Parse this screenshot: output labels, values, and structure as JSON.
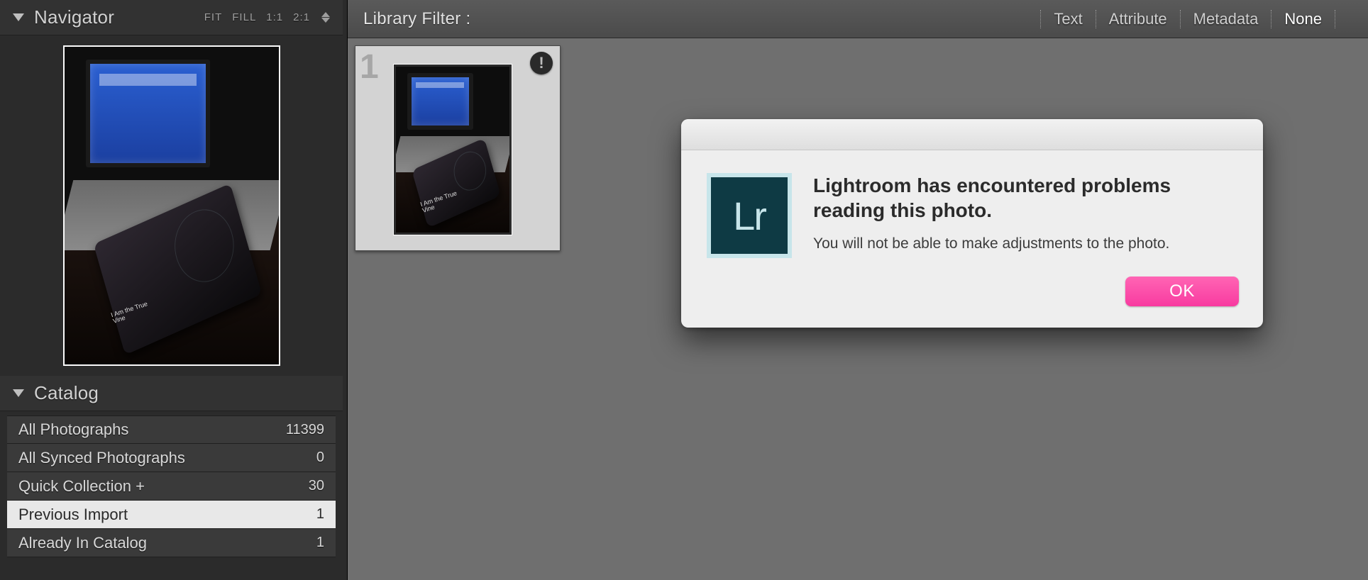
{
  "sidebar": {
    "navigator": {
      "title": "Navigator",
      "zoom": {
        "fit": "FIT",
        "fill": "FILL",
        "one_one": "1:1",
        "two_one": "2:1"
      },
      "preview_caption": "I Am the True\nVine"
    },
    "catalog": {
      "title": "Catalog",
      "items": [
        {
          "label": "All Photographs",
          "count": "11399",
          "selected": false
        },
        {
          "label": "All Synced Photographs",
          "count": "0",
          "selected": false
        },
        {
          "label": "Quick Collection  +",
          "count": "30",
          "selected": false
        },
        {
          "label": "Previous Import",
          "count": "1",
          "selected": true
        },
        {
          "label": "Already In Catalog",
          "count": "1",
          "selected": false
        }
      ]
    }
  },
  "filter_bar": {
    "title": "Library Filter :",
    "options": [
      {
        "label": "Text",
        "active": false
      },
      {
        "label": "Attribute",
        "active": false
      },
      {
        "label": "Metadata",
        "active": false
      },
      {
        "label": "None",
        "active": true
      }
    ]
  },
  "grid": {
    "thumb_index": "1",
    "thumb_caption": "I Am the True\nVine"
  },
  "dialog": {
    "logo_text": "Lr",
    "heading": "Lightroom has encountered problems reading this photo.",
    "body": "You will not be able to make adjustments to the photo.",
    "ok_label": "OK"
  }
}
